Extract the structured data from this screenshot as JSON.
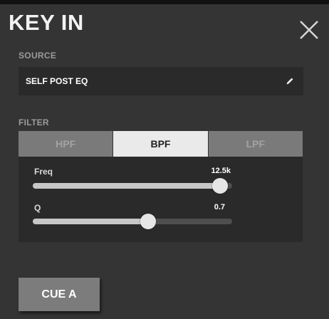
{
  "header": {
    "title": "KEY IN"
  },
  "source": {
    "label": "SOURCE",
    "value": "SELF POST EQ"
  },
  "filter": {
    "label": "FILTER",
    "tabs": [
      "HPF",
      "BPF",
      "LPF"
    ],
    "active_tab": "BPF",
    "freq": {
      "label": "Freq",
      "value": "12.5k",
      "position": 0.94
    },
    "q": {
      "label": "Q",
      "value": "0.7",
      "position": 0.58
    }
  },
  "cue_button": {
    "label": "CUE A"
  },
  "colors": {
    "background": "#343434",
    "field": "#2a2a2a",
    "tab_active": "#eaeaea",
    "tab_inactive": "#7a7a7a"
  }
}
